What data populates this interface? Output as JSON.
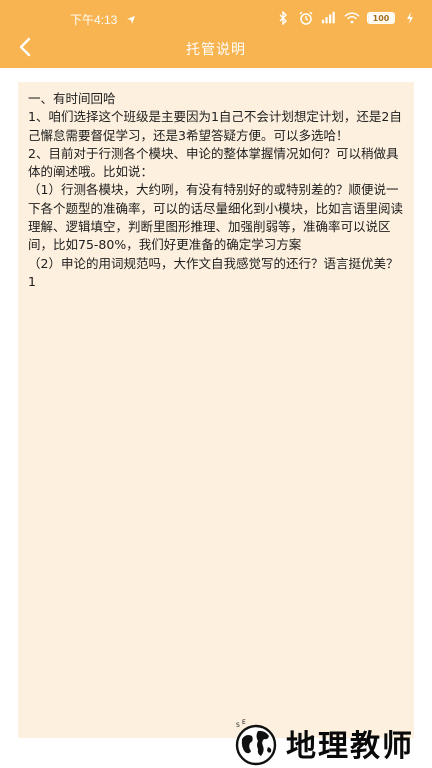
{
  "status_bar": {
    "time": "下午4:13",
    "battery_label": "100",
    "battery_level": 1.0,
    "icons": [
      "location-arrow-icon",
      "bluetooth-icon",
      "alarm-icon",
      "signal-hd-icon",
      "wifi-icon",
      "battery-icon",
      "charging-icon"
    ]
  },
  "header": {
    "title": "托管说明",
    "back_icon": "chevron-left-icon",
    "background_color": "#f7b450"
  },
  "content": {
    "text": "一、有时间回哈\n1、咱们选择这个班级是主要因为1自己不会计划想定计划，还是2自己懈怠需要督促学习，还是3希望答疑方便。可以多选哈！\n2、目前对于行测各个模块、申论的整体掌握情况如何？可以稍做具体的阐述哦。比如说：\n（1）行测各模块，大约咧，有没有特别好的或特别差的？顺便说一下各个题型的准确率，可以的话尽量细化到小模块，比如言语里阅读理解、逻辑填空，判断里图形推理、加强削弱等，准确率可以说区间，比如75-80%，我们好更准备的确定学习方案\n（2）申论的用词规范吗，大作文自我感觉写的还行？语言挺优美？1",
    "background_color": "#fdf0df"
  },
  "watermark": {
    "text": "地理教师",
    "logo_letters": "SE"
  }
}
